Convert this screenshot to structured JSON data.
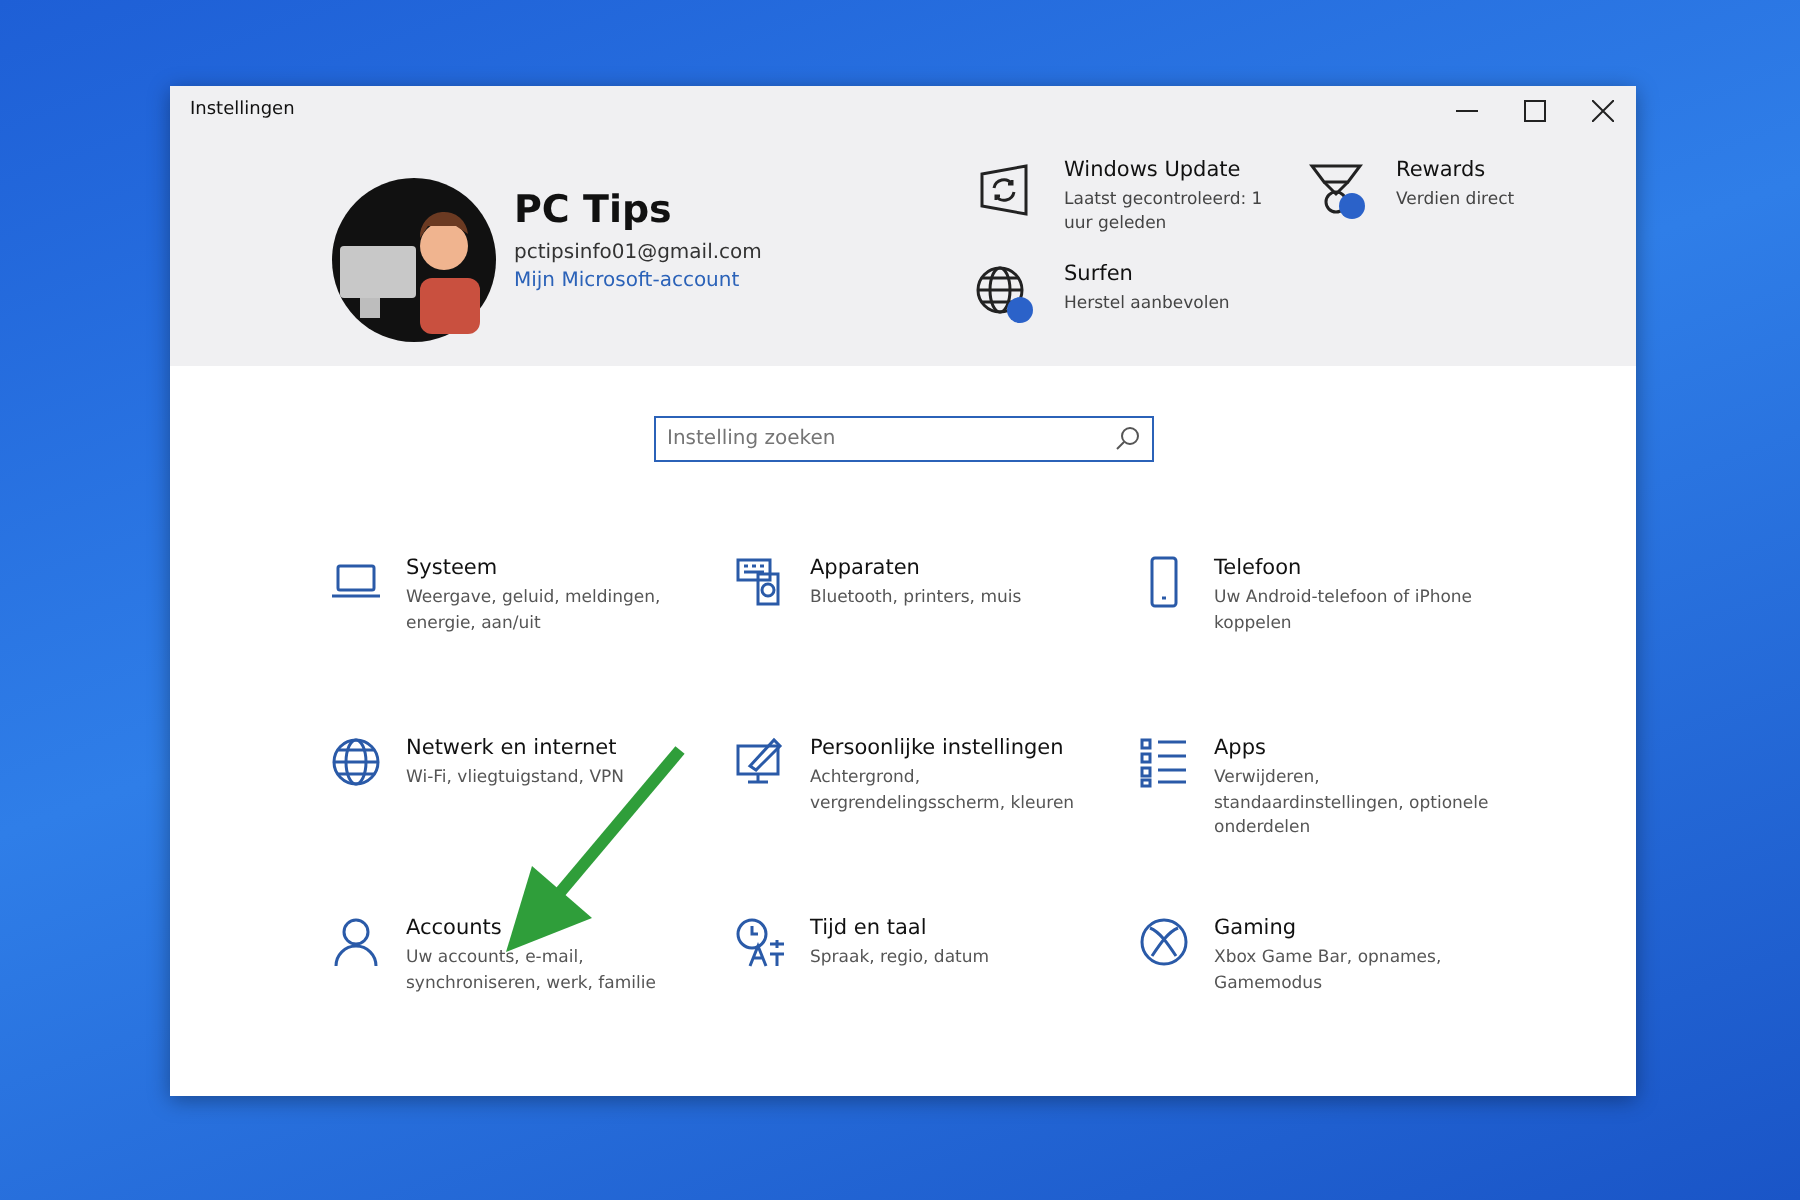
{
  "window": {
    "title": "Instellingen"
  },
  "profile": {
    "name": "PC Tips",
    "email": "pctipsinfo01@gmail.com",
    "link": "Mijn Microsoft-account"
  },
  "status_items": [
    {
      "kind": "update",
      "title": "Windows Update",
      "subtitle": "Laatst gecontroleerd: 1 uur geleden",
      "badge": false
    },
    {
      "kind": "rewards",
      "title": "Rewards",
      "subtitle": "Verdien direct",
      "badge": true
    },
    {
      "kind": "browse",
      "title": "Surfen",
      "subtitle": "Herstel aanbevolen",
      "badge": true
    }
  ],
  "search": {
    "placeholder": "Instelling zoeken"
  },
  "categories": [
    {
      "kind": "system",
      "title": "Systeem",
      "subtitle": "Weergave, geluid, meldingen, energie, aan/uit"
    },
    {
      "kind": "devices",
      "title": "Apparaten",
      "subtitle": "Bluetooth, printers, muis"
    },
    {
      "kind": "phone",
      "title": "Telefoon",
      "subtitle": "Uw Android-telefoon of iPhone koppelen"
    },
    {
      "kind": "network",
      "title": "Netwerk en internet",
      "subtitle": "Wi-Fi, vliegtuigstand, VPN"
    },
    {
      "kind": "personalize",
      "title": "Persoonlijke instellingen",
      "subtitle": "Achtergrond, vergrendelingsscherm, kleuren"
    },
    {
      "kind": "apps",
      "title": "Apps",
      "subtitle": "Verwijderen, standaardinstellingen, optionele onderdelen"
    },
    {
      "kind": "accounts",
      "title": "Accounts",
      "subtitle": "Uw accounts, e-mail, synchroniseren, werk, familie"
    },
    {
      "kind": "time",
      "title": "Tijd en taal",
      "subtitle": "Spraak, regio, datum"
    },
    {
      "kind": "gaming",
      "title": "Gaming",
      "subtitle": "Xbox Game Bar, opnames, Gamemodus"
    }
  ]
}
